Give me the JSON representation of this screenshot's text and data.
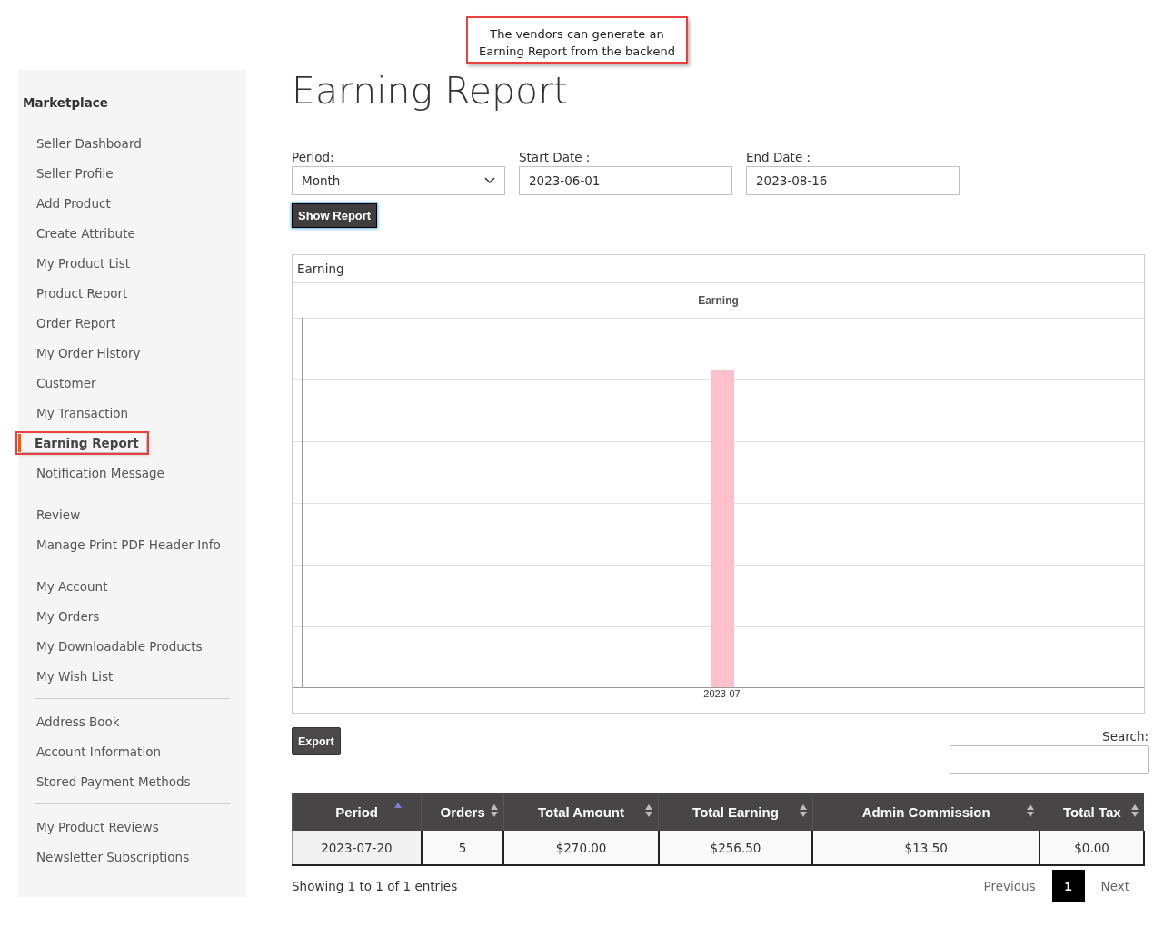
{
  "callout": "The vendors can generate an Earning Report from the backend",
  "sidebar": {
    "title": "Marketplace",
    "groups": [
      {
        "kind": "plain",
        "items": [
          {
            "label": "Seller Dashboard",
            "selected": false
          },
          {
            "label": "Seller Profile",
            "selected": false
          },
          {
            "label": "Add Product",
            "selected": false
          },
          {
            "label": "Create Attribute",
            "selected": false
          },
          {
            "label": "My Product List",
            "selected": false
          },
          {
            "label": "Product Report",
            "selected": false
          },
          {
            "label": "Order Report",
            "selected": false
          },
          {
            "label": "My Order History",
            "selected": false
          },
          {
            "label": "Customer",
            "selected": false
          },
          {
            "label": "My Transaction",
            "selected": false
          },
          {
            "label": "Earning Report",
            "selected": true
          },
          {
            "label": "Notification Message",
            "selected": false
          }
        ]
      },
      {
        "kind": "gap",
        "items": [
          {
            "label": "Review",
            "selected": false
          },
          {
            "label": "Manage Print PDF Header Info",
            "selected": false
          }
        ]
      },
      {
        "kind": "gap",
        "items": [
          {
            "label": "My Account",
            "selected": false
          },
          {
            "label": "My Orders",
            "selected": false
          },
          {
            "label": "My Downloadable Products",
            "selected": false
          },
          {
            "label": "My Wish List",
            "selected": false
          }
        ]
      },
      {
        "kind": "line",
        "items": [
          {
            "label": "Address Book",
            "selected": false
          },
          {
            "label": "Account Information",
            "selected": false
          },
          {
            "label": "Stored Payment Methods",
            "selected": false
          }
        ]
      },
      {
        "kind": "line",
        "items": [
          {
            "label": "My Product Reviews",
            "selected": false
          },
          {
            "label": "Newsletter Subscriptions",
            "selected": false
          }
        ]
      }
    ]
  },
  "page_title": "Earning Report",
  "form": {
    "period": {
      "label": "Period:",
      "value": "Month"
    },
    "start_date": {
      "label": "Start Date :",
      "value": "2023-06-01"
    },
    "end_date": {
      "label": "End Date :",
      "value": "2023-08-16"
    },
    "button": "Show Report"
  },
  "chart_panel": {
    "heading": "Earning",
    "chart_title": "Earning",
    "x_label": "2023-07"
  },
  "export_button": "Export",
  "search": {
    "label": "Search:"
  },
  "table": {
    "columns": [
      {
        "label": "Period",
        "sorted": true
      },
      {
        "label": "Orders",
        "sorted": false
      },
      {
        "label": "Total Amount",
        "sorted": false
      },
      {
        "label": "Total Earning",
        "sorted": false
      },
      {
        "label": "Admin Commission",
        "sorted": false
      },
      {
        "label": "Total Tax",
        "sorted": false
      }
    ],
    "rows": [
      [
        "2023-07-20",
        "5",
        "$270.00",
        "$256.50",
        "$13.50",
        "$0.00"
      ]
    ]
  },
  "info": "Showing 1 to 1 of 1 entries",
  "pagination": {
    "previous": "Previous",
    "pages": [
      {
        "label": "1",
        "selected": true
      }
    ],
    "next": "Next"
  }
}
